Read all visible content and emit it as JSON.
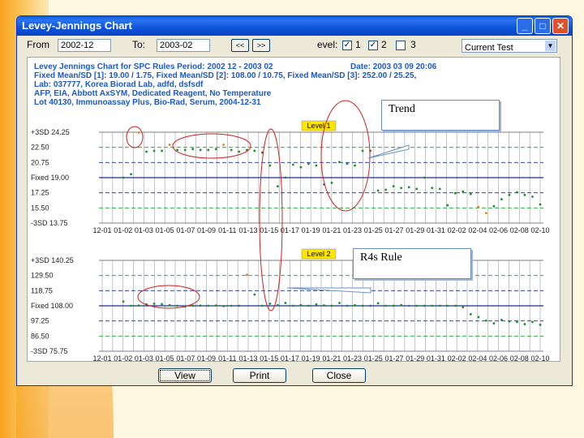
{
  "window": {
    "title": "Levey-Jennings Chart",
    "min": "_",
    "max": "□",
    "close": "✕"
  },
  "toolbar": {
    "from_label": "From",
    "from_value": "2002-12",
    "to_label": "To:",
    "to_value": "2003-02",
    "prev": "<<",
    "next": ">>",
    "level_label": "evel:",
    "levels": [
      {
        "label": "1",
        "checked": true
      },
      {
        "label": "2",
        "checked": true
      },
      {
        "label": "3",
        "checked": false
      }
    ],
    "test_select": "Current Test"
  },
  "report": {
    "lines": [
      "Levey Jennings Chart for SPC Rules    Period: 2002 12 - 2003 02",
      "Fixed Mean/SD [1]: 19.00 / 1.75, Fixed Mean/SD [2]: 108.00 / 10.75, Fixed Mean/SD [3]: 252.00 / 25.25,",
      "Lab: 037777, Korea Biorad Lab, adfd, dsfsdf",
      "AFP, EIA, Abbott AxSYM, Dedicated Reagent, No Temperature",
      "Lot 40130, Immunoassay Plus, Bio-Rad, Serum, 2004-12-31"
    ],
    "date": "Date: 2003 03 09 20:06"
  },
  "chart_data": [
    {
      "type": "scatter",
      "title": "Level 1",
      "y_ticks": [
        "+3SD 24.25",
        "22.50",
        "20.75",
        "Fixed 19.00",
        "17.25",
        "15.50",
        "-3SD 13.75"
      ],
      "ylim": [
        13.75,
        24.25
      ],
      "x_ticks": [
        "12-01",
        "01-02",
        "01-03",
        "01-05",
        "01-07",
        "01-09",
        "01-11",
        "01-13",
        "01-15",
        "01-17",
        "01-19",
        "01-21",
        "01-23",
        "01-25",
        "01-27",
        "01-29",
        "01-31",
        "02-02",
        "02-04",
        "02-06",
        "02-08",
        "02-10"
      ],
      "points": [
        19.0,
        19.4,
        24.2,
        22.0,
        22.1,
        22.1,
        22.8,
        22.2,
        22.2,
        22.3,
        22.2,
        22.2,
        22.3,
        22.8,
        22.2,
        22.0,
        22.2,
        22.1,
        21.9,
        20.4,
        18.0,
        19.0,
        20.5,
        20.2,
        20.6,
        20.4,
        18.2,
        18.4,
        20.8,
        20.6,
        20.4,
        22.1,
        22.1,
        17.5,
        17.6,
        18.0,
        17.8,
        17.9,
        17.7,
        19.0,
        17.8,
        17.7,
        15.8,
        17.2,
        17.4,
        17.1,
        15.6,
        14.9,
        15.7,
        16.5,
        17.0,
        17.3,
        17.0,
        16.8,
        15.9
      ]
    },
    {
      "type": "scatter",
      "title": "Level 2",
      "y_ticks": [
        "+3SD 140.25",
        "129.50",
        "118.75",
        "Fixed 108.00",
        "97.25",
        "86.50",
        "-3SD 75.75"
      ],
      "ylim": [
        75.75,
        140.25
      ],
      "x_ticks": [
        "12-01",
        "01-02",
        "01-03",
        "01-05",
        "01-07",
        "01-09",
        "01-11",
        "01-13",
        "01-15",
        "01-17",
        "01-19",
        "01-21",
        "01-23",
        "01-25",
        "01-27",
        "01-29",
        "01-31",
        "02-02",
        "02-04",
        "02-06",
        "02-08",
        "02-10"
      ],
      "points": [
        111.0,
        108.0,
        108.2,
        109.0,
        109.5,
        109.2,
        108.5,
        108.0,
        107.5,
        108.0,
        108.1,
        108.0,
        108.2,
        107.8,
        108.0,
        108.0,
        130.0,
        116.0,
        108.0,
        109.5,
        108.5,
        110.0,
        108.0,
        108.5,
        108.0,
        109.0,
        108.3,
        108.0,
        110.0,
        108.0,
        108.4,
        108.0,
        108.0,
        109.8,
        108.0,
        108.0,
        108.5,
        108.0,
        108.0,
        108.0,
        108.0,
        108.0,
        108.0,
        108.0,
        107.0,
        102.0,
        100.0,
        97.5,
        95.5,
        98.0,
        97.0,
        96.5,
        95.0,
        96.5,
        94.5
      ]
    }
  ],
  "annotations": {
    "trend": "Trend",
    "r4s": "R4s Rule",
    "level1_tag": "Level 1",
    "level2_tag": "Level 2"
  },
  "buttons": {
    "view": "View",
    "print": "Print",
    "close": "Close"
  },
  "colors": {
    "point": "#1a8f2a",
    "outlier": "#d08a1e",
    "mean_line": "#1c2f8f",
    "sd_line": "#1c9c30",
    "circle": "#d02020"
  }
}
